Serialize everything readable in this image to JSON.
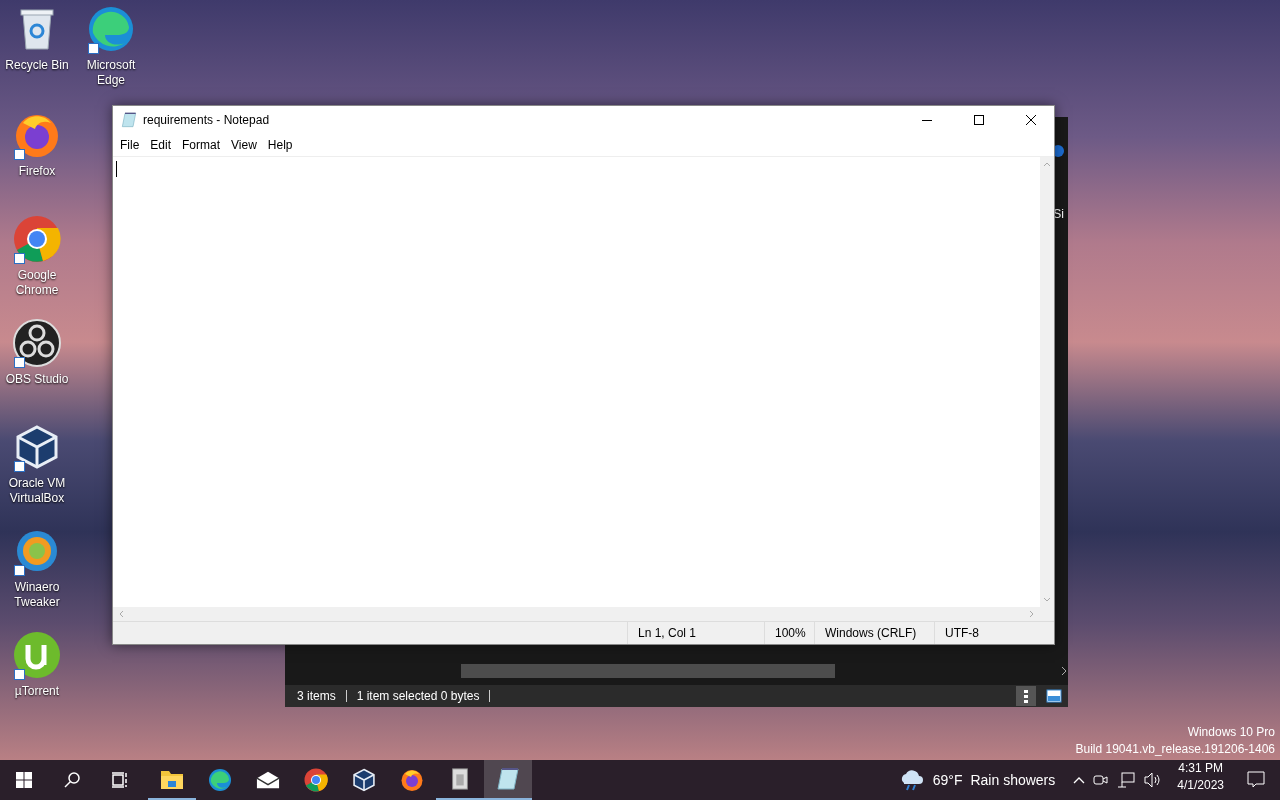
{
  "desktop_icons": [
    {
      "kind": "recycle",
      "label": "Recycle Bin",
      "shortcut": false
    },
    {
      "kind": "edge",
      "label": "Microsoft Edge",
      "shortcut": true
    },
    {
      "kind": "firefox",
      "label": "Firefox",
      "shortcut": true
    },
    {
      "kind": "chrome",
      "label": "Google Chrome",
      "shortcut": true
    },
    {
      "kind": "obs",
      "label": "OBS Studio",
      "shortcut": true
    },
    {
      "kind": "virtualbox",
      "label": "Oracle VM VirtualBox",
      "shortcut": true
    },
    {
      "kind": "winaero",
      "label": "Winaero Tweaker",
      "shortcut": true
    },
    {
      "kind": "utorrent",
      "label": "µTorrent",
      "shortcut": true
    }
  ],
  "explorer": {
    "column_text": "Si",
    "status_items": "3 items",
    "status_selection": "1 item selected 0 bytes"
  },
  "notepad": {
    "title": "requirements - Notepad",
    "menu": [
      "File",
      "Edit",
      "Format",
      "View",
      "Help"
    ],
    "status": {
      "position": "Ln 1, Col 1",
      "zoom": "100%",
      "line_ending": "Windows (CRLF)",
      "encoding": "UTF-8"
    }
  },
  "watermark": {
    "edition": "Windows 10 Pro",
    "build": "Build 19041.vb_release.191206-1406"
  },
  "taskbar": {
    "apps": [
      {
        "kind": "explorer",
        "running": true,
        "selected": false
      },
      {
        "kind": "edge",
        "running": false,
        "selected": false
      },
      {
        "kind": "mail",
        "running": false,
        "selected": false
      },
      {
        "kind": "chrome",
        "running": false,
        "selected": false
      },
      {
        "kind": "virtualbox",
        "running": false,
        "selected": false
      },
      {
        "kind": "firefox",
        "running": false,
        "selected": false
      },
      {
        "kind": "archive",
        "running": true,
        "selected": false
      },
      {
        "kind": "notepad",
        "running": true,
        "selected": true
      }
    ],
    "weather": {
      "temperature": "69°F",
      "condition": "Rain showers"
    },
    "time": "4:31 PM",
    "date": "4/1/2023"
  }
}
